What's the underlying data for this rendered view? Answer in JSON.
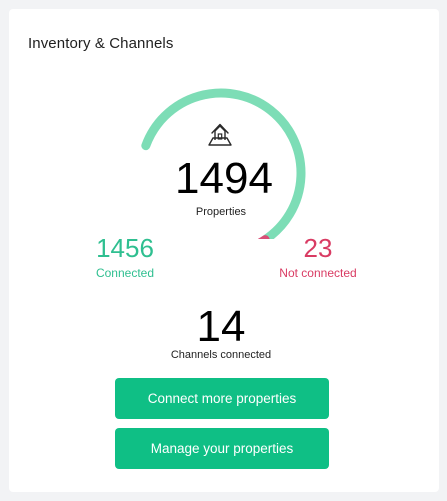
{
  "card": {
    "title": "Inventory & Channels"
  },
  "gauge": {
    "connected_fraction": 0.984,
    "colors": {
      "connected": "#7dddb6",
      "not_connected": "#d94f77"
    },
    "icon": "house-icon"
  },
  "properties": {
    "total": "1494",
    "label": "Properties"
  },
  "connected": {
    "value": "1456",
    "label": "Connected",
    "color": "#2fbf90"
  },
  "not_connected": {
    "value": "23",
    "label": "Not connected",
    "color": "#d93b63"
  },
  "channels": {
    "value": "14",
    "label": "Channels connected"
  },
  "actions": {
    "connect_label": "Connect more properties",
    "manage_label": "Manage your properties",
    "button_color": "#0fbf85"
  }
}
